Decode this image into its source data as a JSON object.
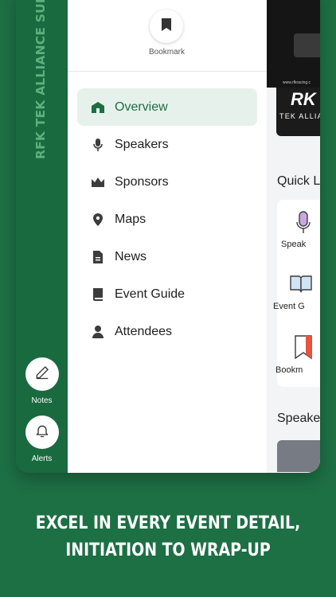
{
  "rail": {
    "title": "RFK TEK ALLIANCE SUMMIT",
    "buttons": [
      {
        "label": "Notes",
        "icon": "pencil-icon"
      },
      {
        "label": "Alerts",
        "icon": "bell-icon"
      }
    ]
  },
  "drawer": {
    "bookmark": {
      "label": "Bookmark",
      "icon": "bookmark-icon"
    },
    "nav": [
      {
        "label": "Overview",
        "icon": "home-icon",
        "active": true
      },
      {
        "label": "Speakers",
        "icon": "microphone-icon"
      },
      {
        "label": "Sponsors",
        "icon": "crown-icon"
      },
      {
        "label": "Maps",
        "icon": "map-pin-icon"
      },
      {
        "label": "News",
        "icon": "document-icon"
      },
      {
        "label": "Event Guide",
        "icon": "book-icon"
      },
      {
        "label": "Attendees",
        "icon": "person-icon"
      }
    ]
  },
  "content": {
    "banner_url": "www.rfkracing.c",
    "banner_logo": "RK",
    "banner_text": "TEK ALLIA",
    "quick_links_title": "Quick L",
    "quick_links": [
      {
        "label": "Speak",
        "icon": "microphone-icon"
      },
      {
        "label": "Event G",
        "icon": "book-open-icon"
      },
      {
        "label": "Bookm",
        "icon": "bookmark-icon"
      }
    ],
    "speakers_title": "Speake"
  },
  "tagline": {
    "line1": "EXCEL IN EVERY EVENT DETAIL,",
    "line2": "INITIATION TO WRAP-UP"
  },
  "colors": {
    "brand_green": "#1d6f44",
    "active_bg": "#e7f1ec",
    "active_text": "#1e6e43"
  }
}
